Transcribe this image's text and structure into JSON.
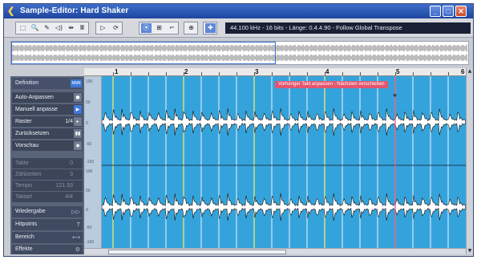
{
  "window": {
    "title": "Sample-Editor: Hard Shaker",
    "minimize_glyph": "_",
    "maximize_glyph": "□",
    "close_glyph": "✕",
    "app_icon": "back-arrow-icon"
  },
  "toolbar": {
    "tool_glyphs": [
      "⬚",
      "🔍",
      "✎",
      "◁)",
      "⇹",
      "Ⅲ"
    ],
    "tool_icons": [
      "range-select-icon",
      "zoom-icon",
      "draw-icon",
      "speaker-icon",
      "time-warp-icon",
      "grid-icon"
    ],
    "play_glyphs": [
      "▷",
      "⟳"
    ],
    "play_icons": [
      "play-icon",
      "loop-icon"
    ],
    "mode_glyphs": [
      "⦿",
      "⊞",
      "⌐"
    ],
    "mode_icons": [
      "snap-icon",
      "autoscroll-icon",
      "hitpoint-icon"
    ],
    "extra_glyphs": [
      "⊕",
      "✚"
    ],
    "extra_icons": [
      "musical-mode-icon",
      "crosshair-icon"
    ],
    "info_text": "44.100 kHz - 16 bits - Länge: 0.4.4.90 - Follow Global Transpose"
  },
  "left_panel": {
    "definition_label": "Definition",
    "definition_button": "NNN",
    "rows": [
      {
        "label": "Auto-Anpassen",
        "value": "",
        "button": "●"
      },
      {
        "label": "Manuell anpasse",
        "value": "",
        "button": "▶"
      },
      {
        "label": "Raster",
        "value": "1/4",
        "button": "▸"
      },
      {
        "label": "Zurücksetzen",
        "value": "",
        "button": "▮▮"
      },
      {
        "label": "Vorschau",
        "value": "",
        "button": "◉"
      }
    ],
    "params": [
      {
        "label": "Takte",
        "value": "0"
      },
      {
        "label": "Zählzeiten",
        "value": "3"
      },
      {
        "label": "Tempo",
        "value": "121.53"
      },
      {
        "label": "Taktart",
        "value": "4/4"
      }
    ],
    "sections": [
      {
        "label": "Wiedergabe",
        "glyph": "▷▷"
      },
      {
        "label": "Hitpoints",
        "glyph": "T"
      },
      {
        "label": "Bereich",
        "glyph": "⟷"
      },
      {
        "label": "Effekte",
        "glyph": "⚙"
      }
    ]
  },
  "ruler": {
    "labels": [
      "1",
      "2",
      "3",
      "4",
      "5",
      "6"
    ]
  },
  "editor": {
    "scale_labels": [
      "100",
      "50",
      "0",
      "-50",
      "-100",
      "100",
      "50",
      "0",
      "-50",
      "-100"
    ],
    "tooltip": "Vorheriger Takt anpassen - Nächsten verschieben",
    "colors": {
      "background": "#35a3db",
      "beat_line": "#ffffff",
      "bar_line": "#e0e47a",
      "waveform_fill": "#ffffff",
      "waveform_stroke": "#111111",
      "cursor_line": "#e24a8a"
    }
  }
}
